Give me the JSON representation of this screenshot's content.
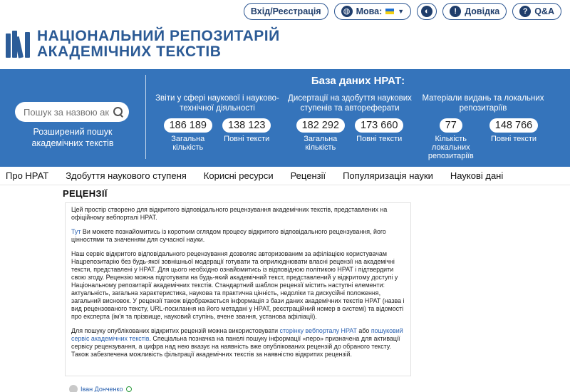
{
  "topbar": {
    "login_label": "Вхід/Реєстрація",
    "language_label": "Мова:",
    "help_label": "Довідка",
    "qa_label": "Q&A",
    "icons": [
      "globe-icon",
      "flag-ukraine-icon",
      "contrast-icon",
      "info-icon",
      "question-icon"
    ]
  },
  "logo": {
    "line1": "НАЦІОНАЛЬНИЙ РЕПОЗИТАРІЙ",
    "line2": "АКАДЕМІЧНИХ ТЕКСТІВ"
  },
  "search": {
    "placeholder": "Пошук за назвою ак",
    "advanced_label": "Розширений пошук академічних текстів"
  },
  "database": {
    "title": "База даних НРАТ:",
    "groups": [
      {
        "title": "Звіти у сфері наукової і науково-технічної діяльності",
        "stats": [
          {
            "value": "186 189",
            "label": "Загальна кількість"
          },
          {
            "value": "138 123",
            "label": "Повні тексти"
          }
        ]
      },
      {
        "title": "Дисертації на здобуття наукових ступенів та автореферати",
        "stats": [
          {
            "value": "182 292",
            "label": "Загальна кількість"
          },
          {
            "value": "173 660",
            "label": "Повні тексти"
          }
        ]
      },
      {
        "title": "Матеріали видань та локальних репозитаріїв",
        "stats": [
          {
            "value": "77",
            "label": "Кількість локальних репозитаріїв"
          },
          {
            "value": "148 766",
            "label": "Повні тексти"
          }
        ]
      }
    ]
  },
  "nav": {
    "items": [
      "Про НРАТ",
      "Здобуття наукового ступеня",
      "Корисні ресурси",
      "Рецензії",
      "Популяризація науки",
      "Наукові дані"
    ]
  },
  "page": {
    "title": "РЕЦЕНЗІЇ",
    "p1": "Цей простір створено для відкритого відповідального рецензування академічних текстів, представлених на офіційному вебпорталі НРАТ.",
    "p2_link": "Тут",
    "p2_text": " Ви можете познайомитись із коротким оглядом процесу відкритого відповідального рецензування, його цінностями та значенням для сучасної науки.",
    "p3": "Наш сервіс відкритого відповідального рецензування дозволяє авторизованим за афіліацією користувачам Нацрепозитарію без будь-якої зовнішньої модерації готувати та оприлюднювати власні рецензії на академічні тексти, представлені у НРАТ. Для цього необхідно ознайомитись із відповідною політикою НРАТ і підтвердити свою згоду.  Рецензію можна підготувати на будь-який академічний текст, представлений у відкритому доступі у Національному репозитарії академічних текстів. Стандартний шаблон рецензії містить наступні елементи: актуальність, загальна характеристика, наукова та практична цінність, недоліки та дискусійні положення, загальний висновок. У рецензії також відображається інформація  з бази даних академічних текстів НРАТ (назва і вид рецензованого тексту, URL-посилання на його метадані у НРАТ, реєстраційний номер в системі) та відомості про експерта (ім'я та прізвище, науковий ступінь, вчене звання, установа афіліації).",
    "p4_a": "Для пошуку опублікованих відкритих рецензій  можна використовувати ",
    "p4_link1": "сторінку вебпорталу НРАТ",
    "p4_b": "  або ",
    "p4_link2": "пошуковий сервіс академічних текстів",
    "p4_c": ". Спеціальна позначка на панелі пошуку інформації «перо» призначена для активації сервісу рецензування, а цифра над нею вказує на наявність вже опублікованих рецензій до обраного тексту. Також забезпечена можливість фільтрації академічних текстів за наявністю відкритих рецензій.",
    "author": "Іван Донченко"
  }
}
